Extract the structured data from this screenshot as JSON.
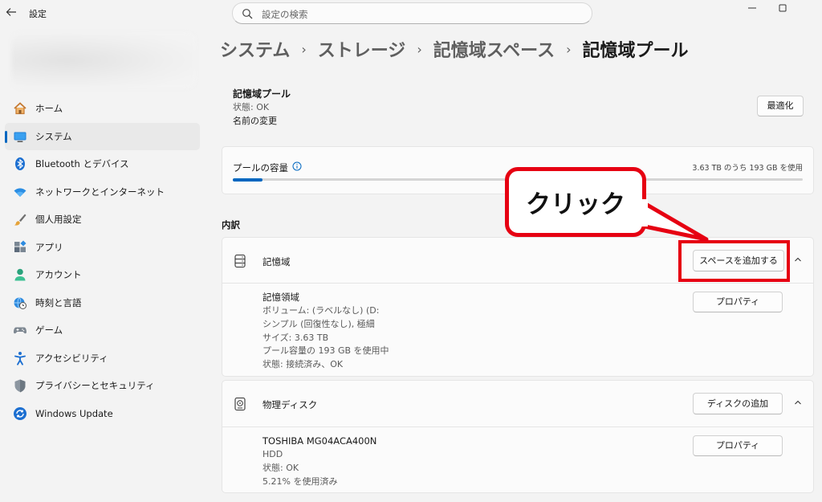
{
  "window": {
    "title": "設定",
    "back_icon": "back-arrow-icon",
    "controls": [
      "minimize-icon",
      "maximize-icon"
    ]
  },
  "search": {
    "placeholder": "設定の検索"
  },
  "sidebar": {
    "items": [
      {
        "label": "ホーム",
        "icon": "home-icon"
      },
      {
        "label": "システム",
        "icon": "system-display-icon",
        "active": true
      },
      {
        "label": "Bluetooth とデバイス",
        "icon": "bluetooth-icon"
      },
      {
        "label": "ネットワークとインターネット",
        "icon": "wifi-icon"
      },
      {
        "label": "個人用設定",
        "icon": "brush-icon"
      },
      {
        "label": "アプリ",
        "icon": "apps-icon"
      },
      {
        "label": "アカウント",
        "icon": "account-icon"
      },
      {
        "label": "時刻と言語",
        "icon": "globe-clock-icon"
      },
      {
        "label": "ゲーム",
        "icon": "gamepad-icon"
      },
      {
        "label": "アクセシビリティ",
        "icon": "accessibility-icon"
      },
      {
        "label": "プライバシーとセキュリティ",
        "icon": "shield-icon"
      },
      {
        "label": "Windows Update",
        "icon": "update-icon"
      }
    ]
  },
  "breadcrumb": {
    "items": [
      "システム",
      "ストレージ",
      "記憶域スペース",
      "記憶域プール"
    ],
    "separator": "›"
  },
  "pool": {
    "title": "記憶域プール",
    "status": "状態: OK",
    "rename_link": "名前の変更",
    "optimize_button": "最適化"
  },
  "capacity": {
    "label": "プールの容量",
    "info_icon": "info-icon",
    "usage_text": "3.63 TB のうち 193 GB を使用",
    "used_fraction": 0.052
  },
  "breakdown": {
    "heading": "内訳",
    "storage": {
      "title": "記憶域",
      "icon": "storage-icon",
      "add_space_button": "スペースを追加する",
      "expanded": true,
      "space": {
        "name": "記憶領域",
        "lines": [
          "ボリューム: (ラベルなし) (D:",
          "シンプル (回復性なし), 極細",
          "サイズ: 3.63 TB",
          "プール容量の 193 GB を使用中",
          "状態: 接続済み、OK"
        ],
        "properties_button": "プロパティ"
      }
    },
    "physical": {
      "title": "物理ディスク",
      "icon": "hard-disk-icon",
      "add_disk_button": "ディスクの追加",
      "expanded": true,
      "disk": {
        "name": "TOSHIBA MG04ACA400N",
        "lines": [
          "HDD",
          "状態: OK",
          "5.21% を使用済み"
        ],
        "properties_button": "プロパティ"
      }
    }
  },
  "annotation": {
    "callout_text": "クリック",
    "color": "#e60012"
  },
  "colors": {
    "accent": "#0067c0",
    "link": "#0050a8",
    "annotation_red": "#e60012"
  }
}
